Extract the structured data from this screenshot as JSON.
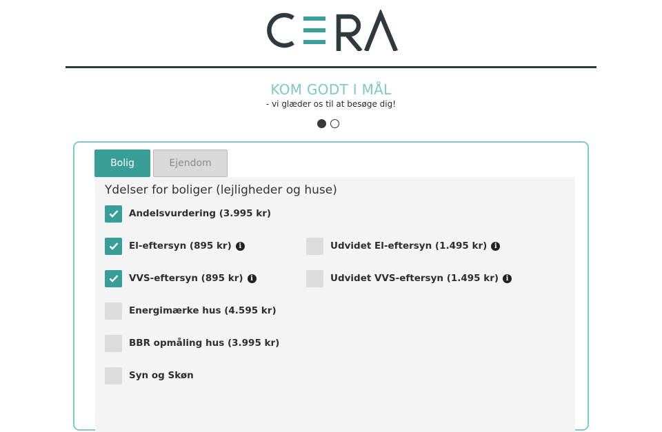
{
  "brand": {
    "logo_text": "CERA",
    "color_dark": "#2f3a3e",
    "color_accent": "#3a9e98"
  },
  "hero": {
    "headline": "KOM GODT I MÅL",
    "subline": "- vi glæder os til at besøge dig!"
  },
  "steps": {
    "total": 2,
    "current": 1
  },
  "tabs": [
    {
      "label": "Bolig",
      "active": true
    },
    {
      "label": "Ejendom",
      "active": false
    }
  ],
  "panel": {
    "title": "Ydelser for boliger (lejligheder og huse)",
    "options": [
      {
        "label": "Andelsvurdering (3.995 kr)",
        "checked": true,
        "info": false
      },
      {
        "label": "El-eftersyn (895 kr)",
        "checked": true,
        "info": true
      },
      {
        "label": "Udvidet El-eftersyn (1.495 kr)",
        "checked": false,
        "info": true
      },
      {
        "label": "VVS-eftersyn (895 kr)",
        "checked": true,
        "info": true
      },
      {
        "label": "Udvidet VVS-eftersyn (1.495 kr)",
        "checked": false,
        "info": true
      },
      {
        "label": "Energimærke hus (4.595 kr)",
        "checked": false,
        "info": false
      },
      {
        "label": "BBR opmåling hus (3.995 kr)",
        "checked": false,
        "info": false
      },
      {
        "label": "Syn og Skøn",
        "checked": false,
        "info": false
      }
    ]
  },
  "icons": {
    "check": "check-icon",
    "info": "info-circle-icon"
  }
}
